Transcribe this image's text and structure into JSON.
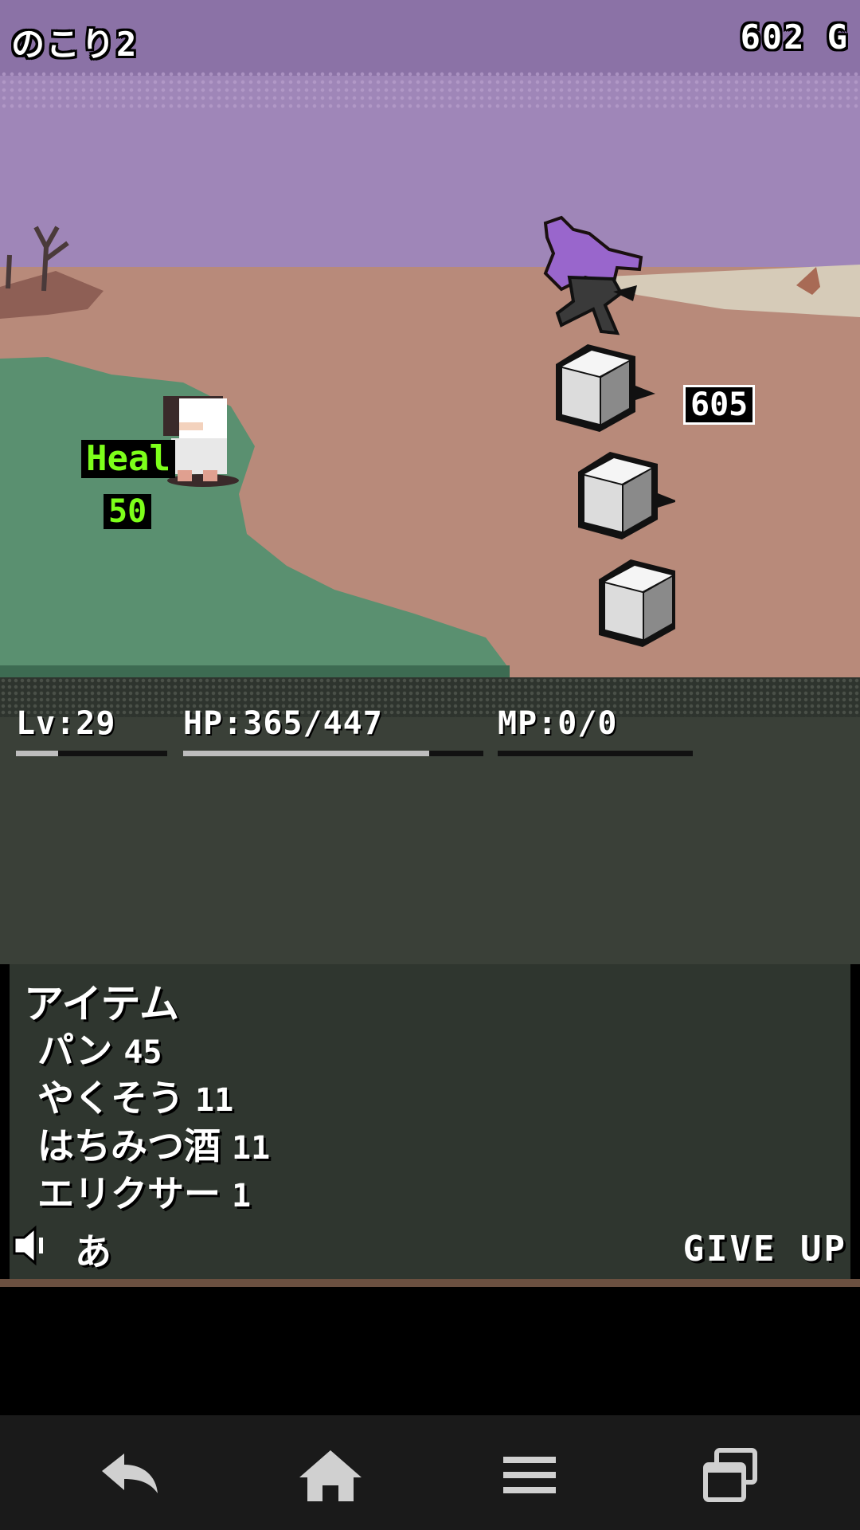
{
  "hud": {
    "remaining": "のこり2",
    "gold": "602 G"
  },
  "battle": {
    "heal_label": "Heal",
    "heal_amount": "50",
    "enemy_hp": "605"
  },
  "stats": {
    "level": "Lv:29",
    "hp": "HP:365/447",
    "mp": "MP:0/0",
    "hp_fraction": 0.82,
    "level_fraction": 0.28,
    "mp_fraction": 0
  },
  "items_panel": {
    "title": "アイテム",
    "items": [
      {
        "name": "パン",
        "qty": "45"
      },
      {
        "name": "やくそう",
        "qty": "11"
      },
      {
        "name": "はちみつ酒",
        "qty": "11"
      },
      {
        "name": "エリクサー",
        "qty": "1"
      }
    ]
  },
  "controls": {
    "auto_label": "あ",
    "give_up": "GIVE UP"
  },
  "colors": {
    "sky": "#9f86b8",
    "ground": "#b88a7a",
    "grass": "#5a9070",
    "heal": "#7dff1a",
    "panel": "#2f362f"
  },
  "icons": {
    "sound": "speaker-icon",
    "back": "back-arrow-icon",
    "home": "home-icon",
    "menu": "menu-icon",
    "recents": "recents-icon"
  }
}
